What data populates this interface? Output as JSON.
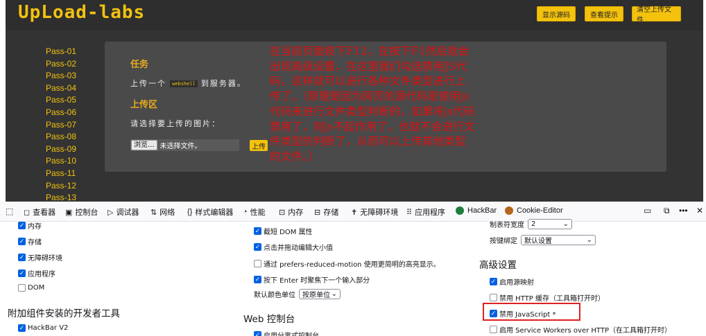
{
  "app": {
    "logo": "UpLoad-labs",
    "buttons": [
      "显示源码",
      "查看提示",
      "清空上传文件"
    ],
    "pass_items": [
      "Pass-01",
      "Pass-02",
      "Pass-03",
      "Pass-04",
      "Pass-05",
      "Pass-06",
      "Pass-07",
      "Pass-08",
      "Pass-09",
      "Pass-10",
      "Pass-11",
      "Pass-12",
      "Pass-13"
    ],
    "task_heading": "任务",
    "task_text_before": "上传一个",
    "task_code": "webshell",
    "task_text_after": "到服务器。",
    "upload_heading": "上传区",
    "upload_prompt": "请选择要上传的图片：",
    "browse_label": "浏览...",
    "no_file_text": "未选择文件。",
    "upload_button": "上传",
    "accent_color": "#f2c20f"
  },
  "annotation": {
    "text": "在当前页面按下F12，在按下F1然后就会出现高级设置，在这里我们勾选禁用JS代码，这样就可以进行各种文件类型进行上传了。（原理是因为网页的源代码是使用js代码来进行文件类型判断的，如果将js代码禁用了，则js不起作用了，也就不会进行文件类型的判断了，从而可以上传其他类型的文件。）",
    "color": "#e01010"
  },
  "devtools": {
    "tabs": [
      {
        "label": "查看器",
        "icon": "inspector-icon"
      },
      {
        "label": "控制台",
        "icon": "console-icon"
      },
      {
        "label": "调试器",
        "icon": "debugger-icon"
      },
      {
        "label": "网络",
        "icon": "network-icon"
      },
      {
        "label": "样式编辑器",
        "icon": "style-editor-icon"
      },
      {
        "label": "性能",
        "icon": "performance-icon"
      },
      {
        "label": "内存",
        "icon": "memory-icon"
      },
      {
        "label": "存储",
        "icon": "storage-icon"
      },
      {
        "label": "无障碍环境",
        "icon": "accessibility-icon"
      },
      {
        "label": "应用程序",
        "icon": "application-icon"
      },
      {
        "label": "HackBar",
        "icon": "hackbar-icon"
      },
      {
        "label": "Cookie-Editor",
        "icon": "cookie-icon"
      }
    ],
    "col1": {
      "items": [
        {
          "label": "内存",
          "checked": true
        },
        {
          "label": "存储",
          "checked": true
        },
        {
          "label": "无障碍环境",
          "checked": true
        },
        {
          "label": "应用程序",
          "checked": true
        },
        {
          "label": "DOM",
          "checked": false
        }
      ],
      "addon_heading": "附加组件安装的开发者工具",
      "addon_item": {
        "label": "HackBar V2",
        "checked": true
      }
    },
    "col2": {
      "items": [
        {
          "label": "截短 DOM 属性",
          "checked": true
        },
        {
          "label": "点击并拖动编辑大小值",
          "checked": true
        },
        {
          "label": "通过 prefers-reduced-motion 使用更简明的高亮显示。",
          "checked": false
        },
        {
          "label": "按下 Enter 时聚焦下一个输入部分",
          "checked": true
        }
      ],
      "color_unit_label": "默认颜色单位",
      "color_unit_value": "按原单位",
      "web_console_heading": "Web 控制台",
      "web_console_item": {
        "label": "启用分离式控制台",
        "checked": true
      }
    },
    "col3": {
      "tab_width_label": "制表符宽度",
      "tab_width_value": "2",
      "keybind_label": "按键绑定",
      "keybind_value": "默认设置",
      "advanced_heading": "高级设置",
      "items": [
        {
          "label": "启用源映射",
          "checked": true
        },
        {
          "label": "禁用 HTTP 缓存（工具箱打开时）",
          "checked": false
        },
        {
          "label": "禁用 JavaScript *",
          "checked": true
        },
        {
          "label": "启用 Service Workers over HTTP（在工具箱打开时）",
          "checked": false
        }
      ]
    },
    "highlight_color": "#e02020"
  }
}
